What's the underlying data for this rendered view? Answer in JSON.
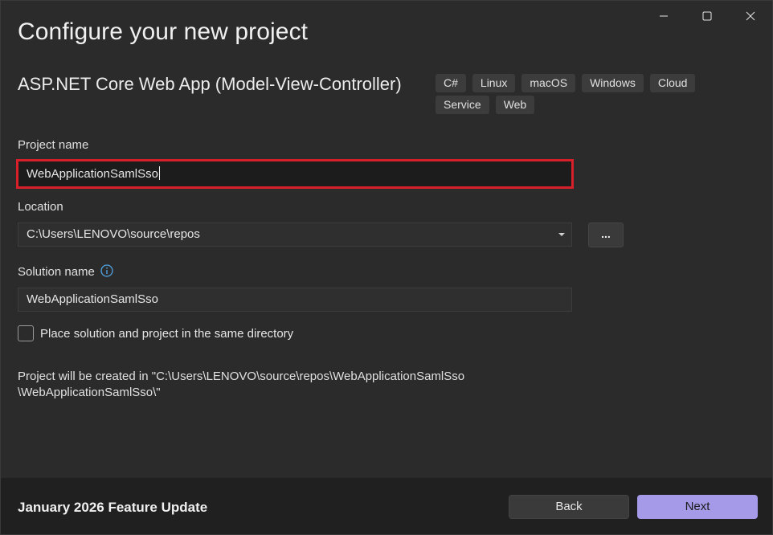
{
  "window": {
    "title": "Configure your new project"
  },
  "template": {
    "name": "ASP.NET Core Web App (Model-View-Controller)",
    "tags": [
      "C#",
      "Linux",
      "macOS",
      "Windows",
      "Cloud",
      "Service",
      "Web"
    ]
  },
  "form": {
    "project_name_label": "Project name",
    "project_name_value": "WebApplicationSamlSso",
    "location_label": "Location",
    "location_value": "C:\\Users\\LENOVO\\source\\repos",
    "browse_label": "...",
    "solution_name_label": "Solution name",
    "solution_name_value": "WebApplicationSamlSso",
    "same_dir_label": "Place solution and project in the same directory",
    "same_dir_checked": false,
    "path_info_line1": "Project will be created in \"C:\\Users\\LENOVO\\source\\repos\\WebApplicationSamlSso",
    "path_info_line2": "\\WebApplicationSamlSso\\\""
  },
  "footer": {
    "update_text": "January 2026 Feature Update",
    "back_label": "Back",
    "next_label": "Next"
  },
  "colors": {
    "background": "#2b2b2b",
    "footer": "#202020",
    "accent": "#a59ae8",
    "focus_border": "#d7202a",
    "info_icon": "#4fa3e0"
  },
  "icons": {
    "minimize": "minimize-icon",
    "maximize": "maximize-icon",
    "close": "close-icon",
    "info": "info-icon",
    "dropdown": "chevron-down-icon"
  }
}
